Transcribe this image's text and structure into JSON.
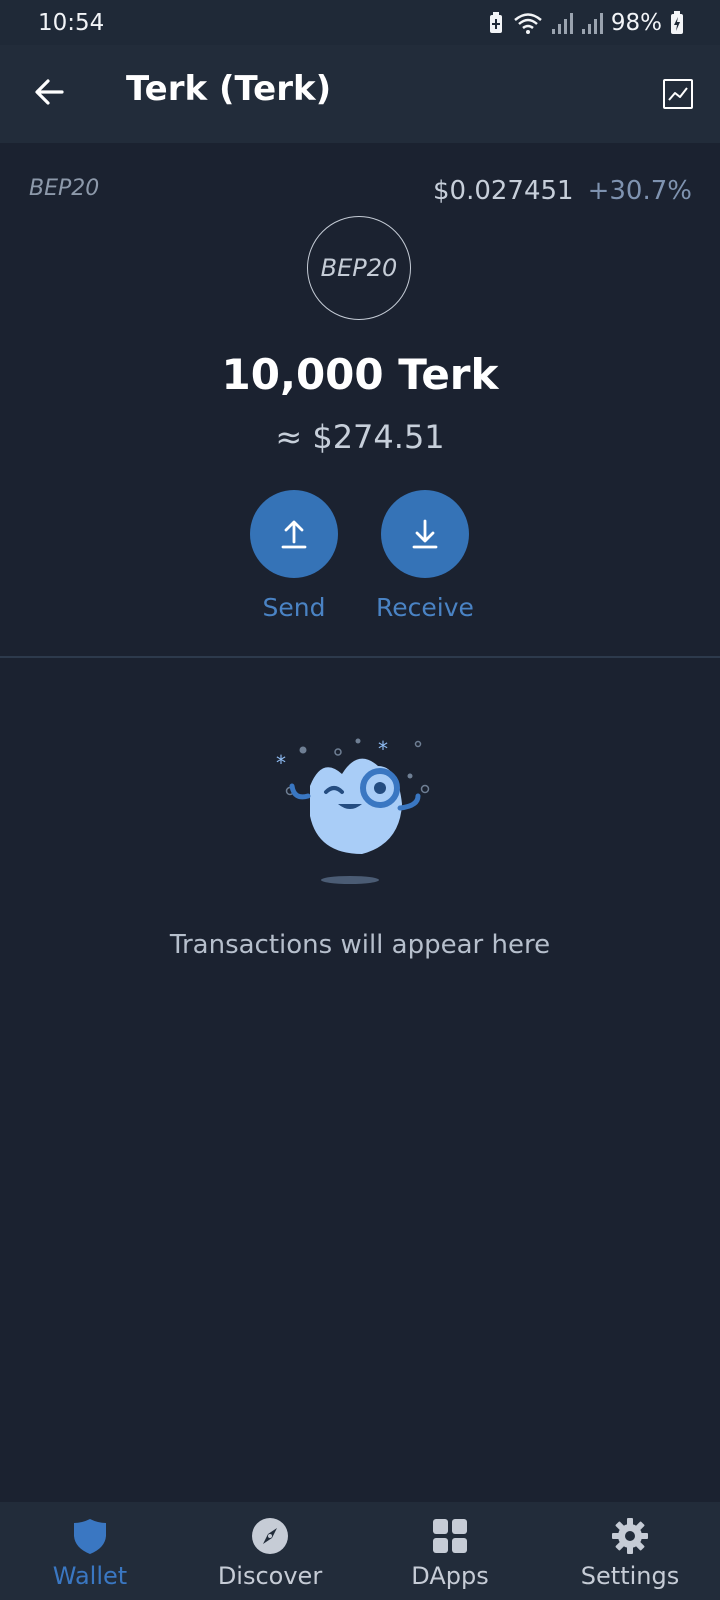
{
  "status_bar": {
    "time": "10:54",
    "battery_percent": "98%"
  },
  "app_bar": {
    "title": "Terk (Terk)",
    "back_icon": "arrow-left-icon",
    "chart_icon": "price-chart-icon"
  },
  "token": {
    "chain_tag": "BEP20",
    "price": "$0.027451",
    "change": "+30.7%",
    "logo_text": "BEP20",
    "balance": "10,000 Terk",
    "fiat_value": "≈ $274.51"
  },
  "actions": {
    "send_label": "Send",
    "receive_label": "Receive",
    "send_icon": "upload-arrow-icon",
    "receive_icon": "download-arrow-icon"
  },
  "empty_state": {
    "message": "Transactions will appear here"
  },
  "bottom_nav": {
    "items": [
      {
        "label": "Wallet",
        "icon": "shield-icon",
        "active": true
      },
      {
        "label": "Discover",
        "icon": "compass-icon",
        "active": false
      },
      {
        "label": "DApps",
        "icon": "grid-icon",
        "active": false
      },
      {
        "label": "Settings",
        "icon": "gear-icon",
        "active": false
      }
    ]
  },
  "colors": {
    "background": "#1b2230",
    "bar": "#222c3a",
    "accent": "#3573b7",
    "active_nav": "#3a77c2"
  }
}
